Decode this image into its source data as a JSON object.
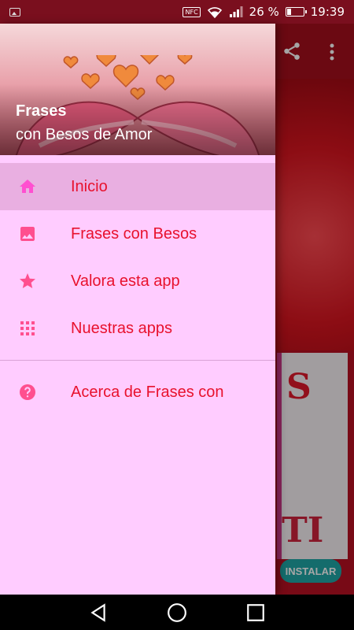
{
  "status_bar": {
    "nfc": "NFC",
    "battery_percent": "26 %",
    "battery_level": 0.26,
    "time": "19:39",
    "icons": [
      "image-notification-icon",
      "nfc-icon",
      "wifi-icon",
      "signal-icon",
      "battery-icon"
    ]
  },
  "drawer": {
    "header": {
      "title": "Frases",
      "subtitle": "con Besos de Amor"
    },
    "items": [
      {
        "label": "Inicio",
        "icon": "home-icon",
        "active": true
      },
      {
        "label": "Frases con Besos",
        "icon": "image-icon",
        "active": false
      },
      {
        "label": "Valora esta app",
        "icon": "star-icon",
        "active": false
      },
      {
        "label": "Nuestras apps",
        "icon": "apps-grid-icon",
        "active": false
      }
    ],
    "secondary_items": [
      {
        "label": "Acerca de Frases con",
        "icon": "help-icon"
      }
    ]
  },
  "background_app": {
    "toolbar_icons": [
      "share-icon",
      "more-vert-icon"
    ],
    "install_button": "INSTALAR"
  },
  "colors": {
    "drawer_bg": "#ffccff",
    "active_item_bg": "#e9afe1",
    "item_text": "#e8112d",
    "icon_color": "#ff4f8f",
    "status_bar": "#7a0f1e"
  },
  "nav_bar": {
    "icons": [
      "back-icon",
      "home-circle-icon",
      "recents-icon"
    ]
  }
}
